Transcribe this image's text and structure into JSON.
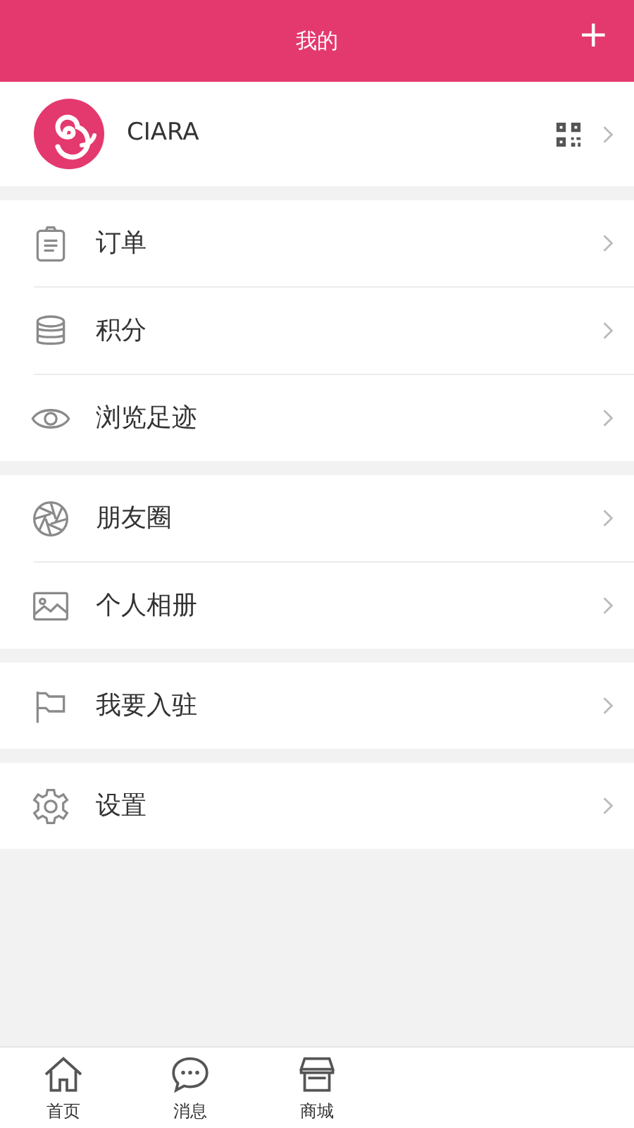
{
  "header": {
    "title": "我的",
    "action": "+"
  },
  "profile": {
    "name": "CIARA"
  },
  "groups": [
    [
      {
        "label": "订单",
        "kind": "clipboard"
      },
      {
        "label": "积分",
        "kind": "coins"
      },
      {
        "label": "浏览足迹",
        "kind": "eye"
      }
    ],
    [
      {
        "label": "朋友圈",
        "kind": "aperture"
      },
      {
        "label": "个人相册",
        "kind": "image"
      }
    ],
    [
      {
        "label": "我要入驻",
        "kind": "flag"
      }
    ],
    [
      {
        "label": "设置",
        "kind": "gear"
      }
    ]
  ],
  "tab_bar": [
    {
      "label": "首页",
      "kind": "home"
    },
    {
      "label": "消息",
      "kind": "chat"
    },
    {
      "label": "商城",
      "kind": "store"
    }
  ]
}
